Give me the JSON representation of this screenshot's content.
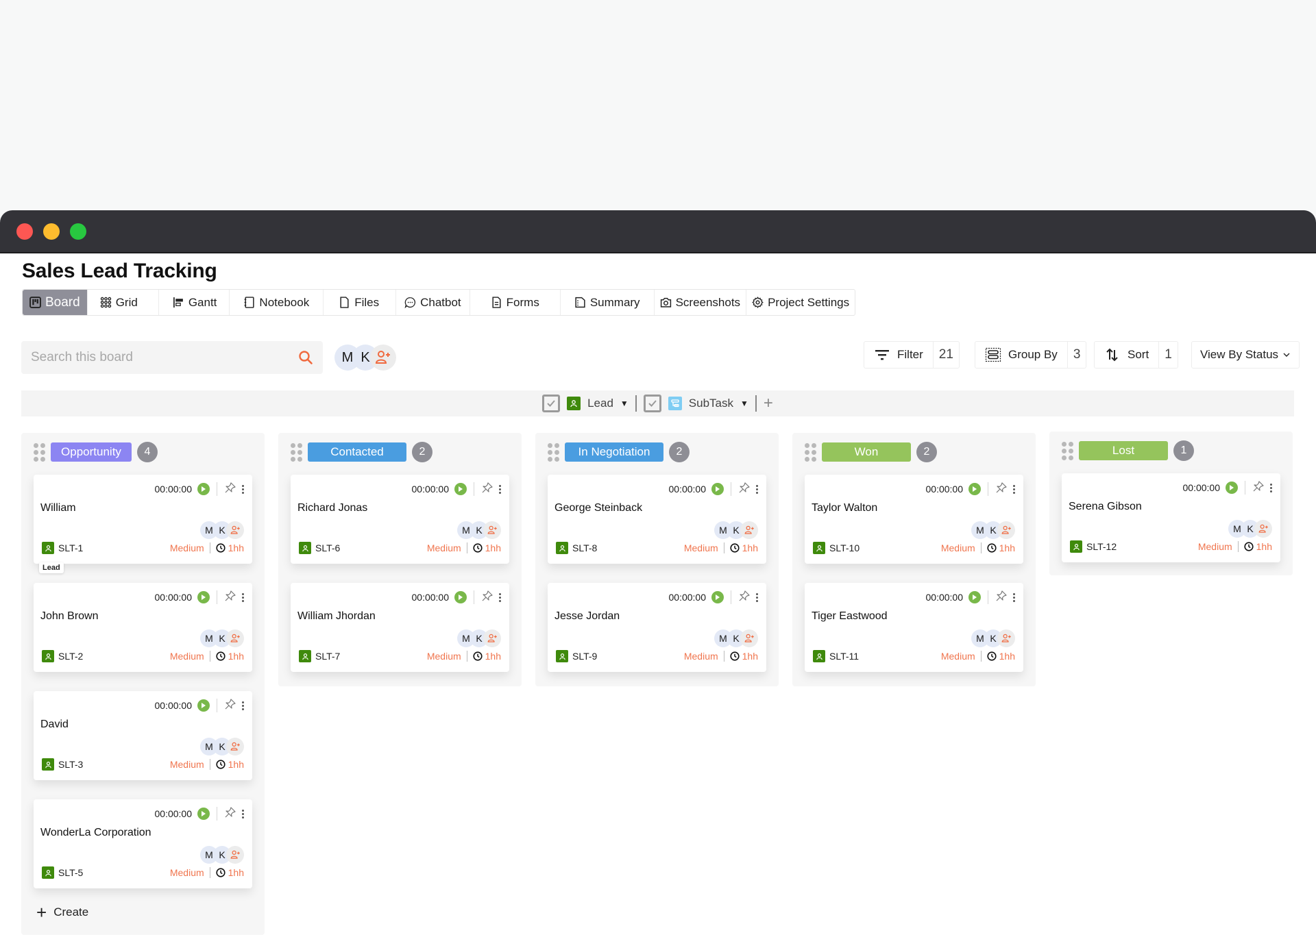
{
  "window": {
    "title": "Sales Lead Tracking"
  },
  "tabs": [
    {
      "id": "board",
      "label": "Board",
      "icon": "board-icon",
      "active": true
    },
    {
      "id": "grid",
      "label": "Grid",
      "icon": "grid-icon"
    },
    {
      "id": "gantt",
      "label": "Gantt",
      "icon": "gantt-icon"
    },
    {
      "id": "notebook",
      "label": "Notebook",
      "icon": "notebook-icon"
    },
    {
      "id": "files",
      "label": "Files",
      "icon": "file-icon"
    },
    {
      "id": "chatbot",
      "label": "Chatbot",
      "icon": "chat-icon"
    },
    {
      "id": "forms",
      "label": "Forms",
      "icon": "form-icon"
    },
    {
      "id": "summary",
      "label": "Summary",
      "icon": "summary-icon"
    },
    {
      "id": "screenshots",
      "label": "Screenshots",
      "icon": "camera-icon"
    },
    {
      "id": "settings",
      "label": "Project Settings",
      "icon": "gear-icon"
    }
  ],
  "search": {
    "placeholder": "Search this board",
    "value": ""
  },
  "members": [
    "M",
    "K"
  ],
  "toolbar": {
    "filter": {
      "label": "Filter",
      "count": "21"
    },
    "group_by": {
      "label": "Group By",
      "count": "3"
    },
    "sort": {
      "label": "Sort",
      "count": "1"
    },
    "view": {
      "label": "View By Status"
    }
  },
  "type_filter": {
    "lead": {
      "label": "Lead",
      "checked": true
    },
    "subtask": {
      "label": "SubTask",
      "checked": true
    }
  },
  "colors": {
    "opportunity": "#8c85f2",
    "contacted": "#4a9de0",
    "negotiation": "#4a9de0",
    "won": "#95c45c",
    "lost": "#95c45c",
    "priority": "#f0754e",
    "lead_badge": "#3f8a0c",
    "play": "#79b84a"
  },
  "columns": [
    {
      "status": "Opportunity",
      "count": "4",
      "cards": [
        {
          "name": "William",
          "id": "SLT-1",
          "timer": "00:00:00",
          "priority": "Medium",
          "estimate": "1hh",
          "tooltip": "Lead"
        },
        {
          "name": "John Brown",
          "id": "SLT-2",
          "timer": "00:00:00",
          "priority": "Medium",
          "estimate": "1hh"
        },
        {
          "name": "David",
          "id": "SLT-3",
          "timer": "00:00:00",
          "priority": "Medium",
          "estimate": "1hh"
        },
        {
          "name": "WonderLa Corporation",
          "id": "SLT-5",
          "timer": "00:00:00",
          "priority": "Medium",
          "estimate": "1hh"
        }
      ],
      "create_label": "Create"
    },
    {
      "status": "Contacted",
      "count": "2",
      "cards": [
        {
          "name": "Richard Jonas",
          "id": "SLT-6",
          "timer": "00:00:00",
          "priority": "Medium",
          "estimate": "1hh"
        },
        {
          "name": "William Jhordan",
          "id": "SLT-7",
          "timer": "00:00:00",
          "priority": "Medium",
          "estimate": "1hh"
        }
      ]
    },
    {
      "status": "In Negotiation",
      "count": "2",
      "cards": [
        {
          "name": "George Steinback",
          "id": "SLT-8",
          "timer": "00:00:00",
          "priority": "Medium",
          "estimate": "1hh"
        },
        {
          "name": "Jesse Jordan",
          "id": "SLT-9",
          "timer": "00:00:00",
          "priority": "Medium",
          "estimate": "1hh"
        }
      ]
    },
    {
      "status": "Won",
      "count": "2",
      "cards": [
        {
          "name": "Taylor Walton",
          "id": "SLT-10",
          "timer": "00:00:00",
          "priority": "Medium",
          "estimate": "1hh"
        },
        {
          "name": "Tiger Eastwood",
          "id": "SLT-11",
          "timer": "00:00:00",
          "priority": "Medium",
          "estimate": "1hh"
        }
      ]
    },
    {
      "status": "Lost",
      "count": "1",
      "cards": [
        {
          "name": "Serena Gibson",
          "id": "SLT-12",
          "timer": "00:00:00",
          "priority": "Medium",
          "estimate": "1hh"
        }
      ]
    }
  ]
}
